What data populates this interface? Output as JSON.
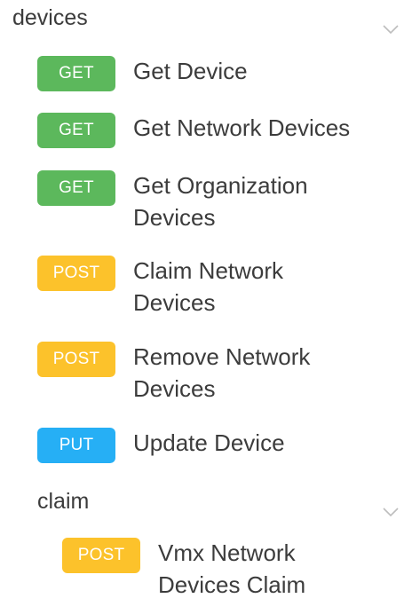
{
  "colors": {
    "get": "#5cb85c",
    "post": "#fcc22b",
    "put": "#26aff5",
    "chevron": "#bdbdbd"
  },
  "sections": [
    {
      "title": "devices",
      "chevron_icon": "chevron-down-icon",
      "endpoints": [
        {
          "method": "GET",
          "label": "Get Device"
        },
        {
          "method": "GET",
          "label": "Get Network Devices"
        },
        {
          "method": "GET",
          "label": "Get Organization Devices"
        },
        {
          "method": "POST",
          "label": "Claim Network Devices"
        },
        {
          "method": "POST",
          "label": "Remove Network Devices"
        },
        {
          "method": "PUT",
          "label": "Update Device"
        }
      ]
    },
    {
      "title": "claim",
      "chevron_icon": "chevron-down-icon",
      "endpoints": [
        {
          "method": "POST",
          "label": "Vmx Network Devices Claim"
        }
      ]
    }
  ]
}
